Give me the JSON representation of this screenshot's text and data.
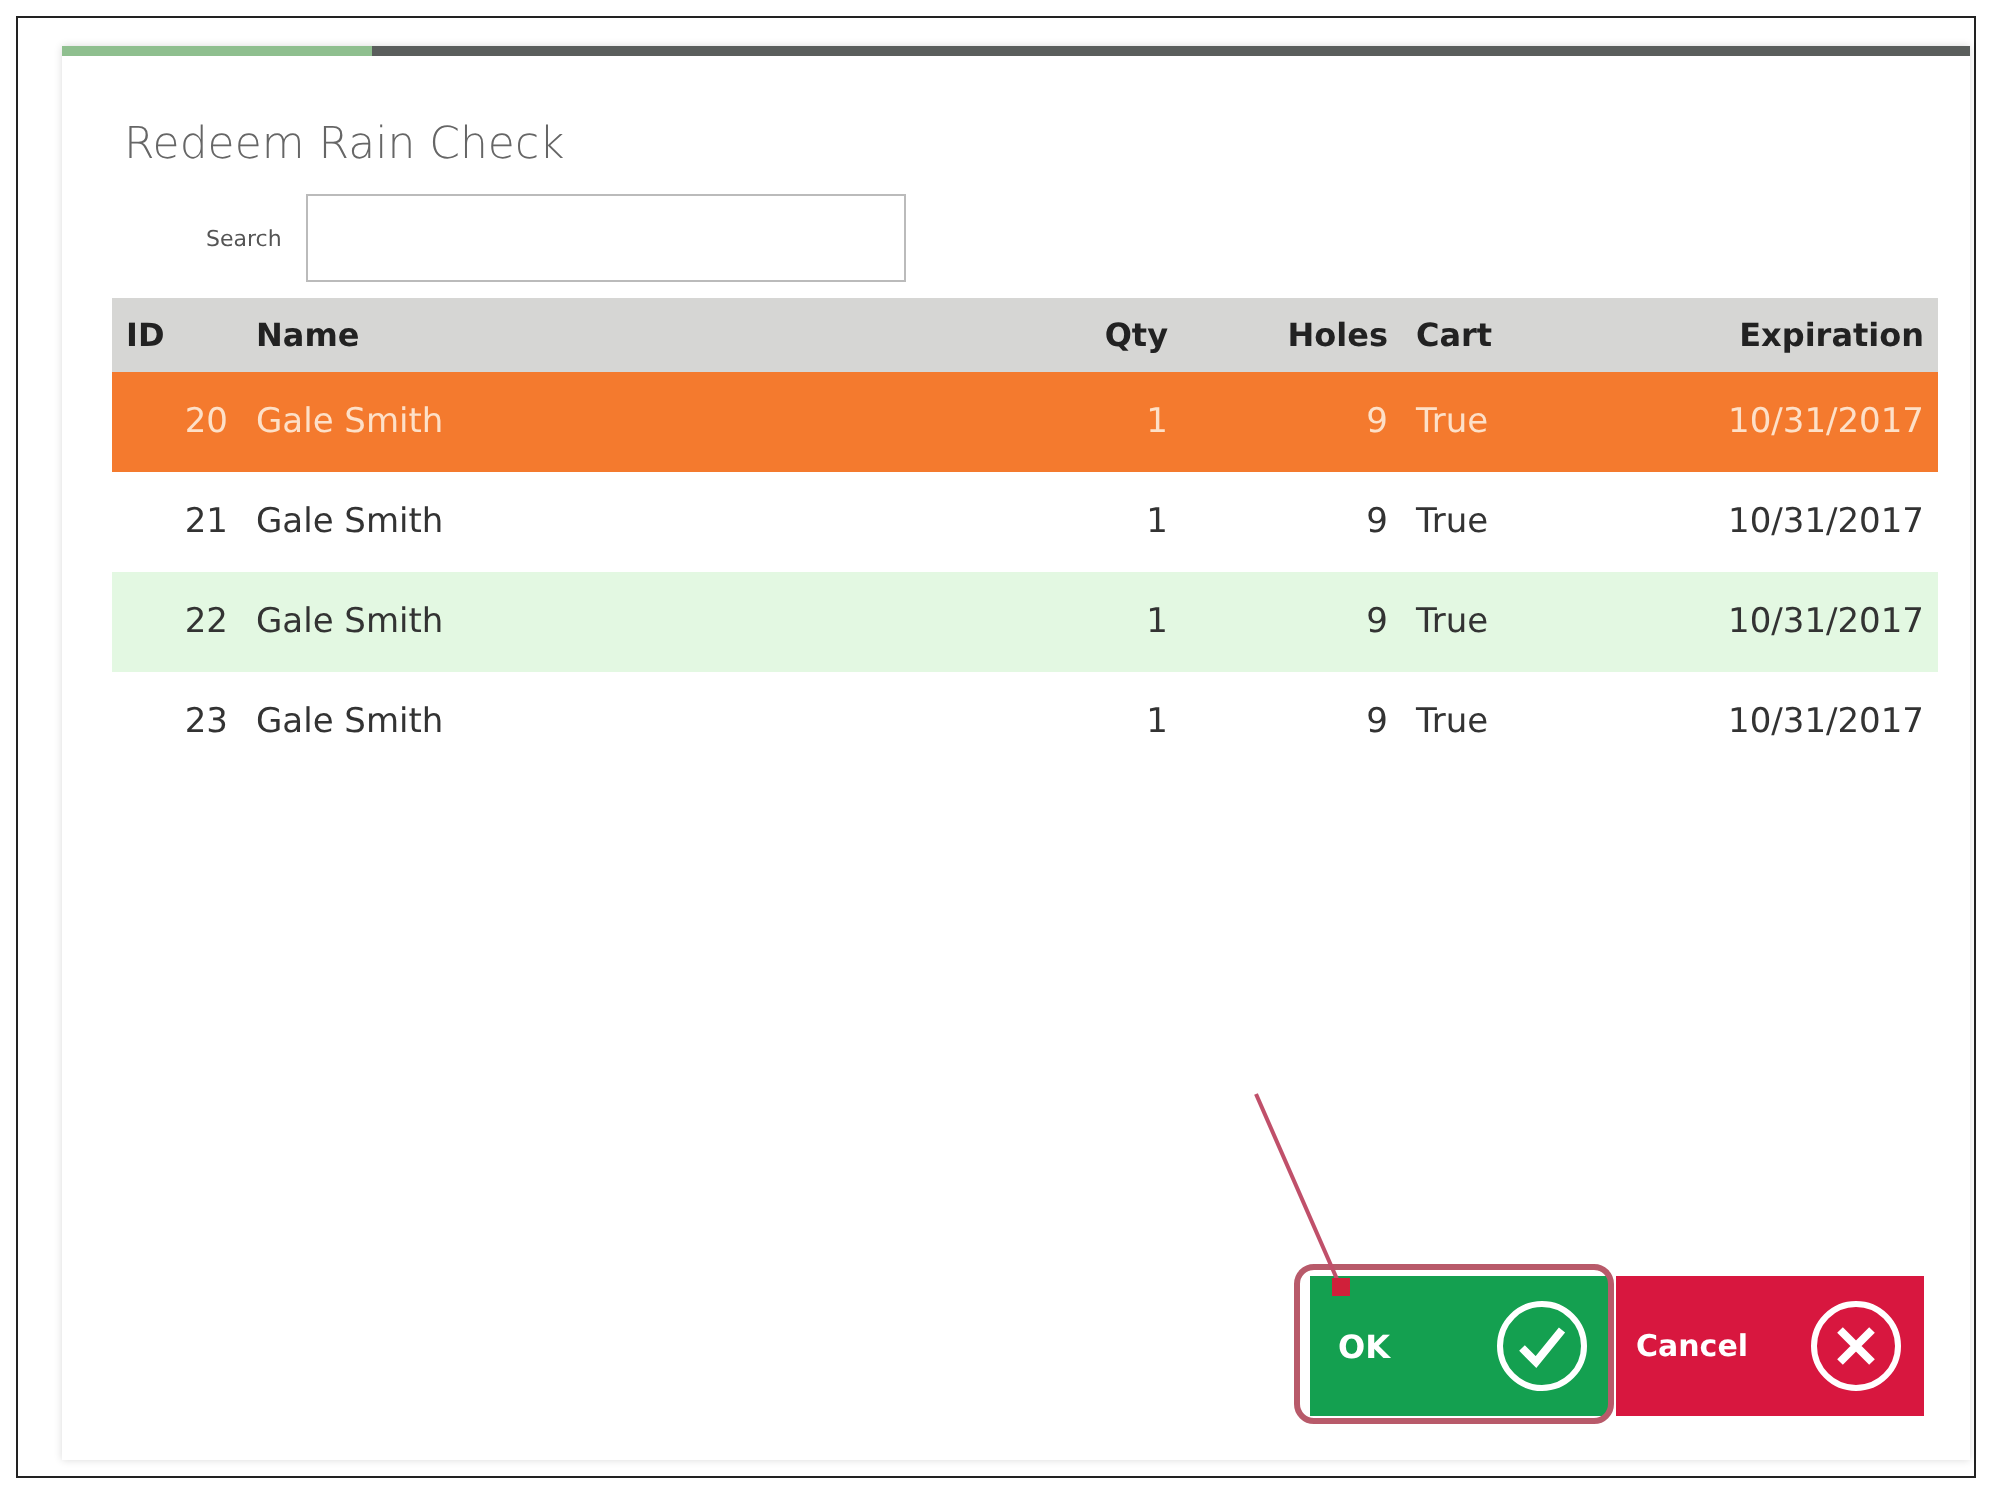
{
  "dialog": {
    "title": "Redeem Rain Check"
  },
  "search": {
    "label": "Search"
  },
  "table": {
    "columns": [
      "ID",
      "Name",
      "Qty",
      "Holes",
      "Cart",
      "Expiration"
    ],
    "rows": [
      {
        "cells": [
          "20",
          "Gale Smith",
          "1",
          "9",
          "True",
          "10/31/2017"
        ],
        "selected": true,
        "highlighted": false
      },
      {
        "cells": [
          "21",
          "Gale Smith",
          "1",
          "9",
          "True",
          "10/31/2017"
        ],
        "selected": false,
        "highlighted": false
      },
      {
        "cells": [
          "22",
          "Gale Smith",
          "1",
          "9",
          "True",
          "10/31/2017"
        ],
        "selected": false,
        "highlighted": true
      },
      {
        "cells": [
          "23",
          "Gale Smith",
          "1",
          "9",
          "True",
          "10/31/2017"
        ],
        "selected": false,
        "highlighted": false
      }
    ]
  },
  "buttons": [
    {
      "kind": "ok",
      "label": "OK"
    },
    {
      "kind": "cancel",
      "label": "Cancel"
    }
  ]
}
